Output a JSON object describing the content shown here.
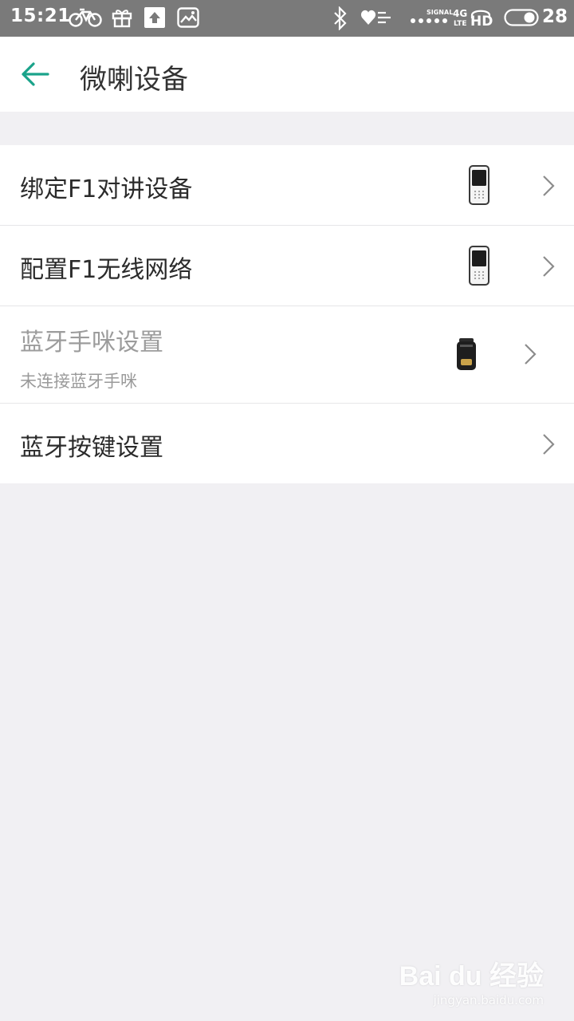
{
  "status_bar": {
    "time": "15:21",
    "signal_label": "SIGNAL",
    "network_label": "4G",
    "network_sub": "LTE",
    "hd_label": "HD",
    "battery": "28",
    "icons": [
      "bike-icon",
      "gift-icon",
      "upload-icon",
      "image-icon",
      "bluetooth-icon",
      "heart-icon",
      "signal-icon",
      "headphones-icon",
      "battery-icon"
    ]
  },
  "app_bar": {
    "title": "微喇设备",
    "back_icon": "arrow-left-icon"
  },
  "colors": {
    "accent": "#1aa38a",
    "status_bar": "#7a7a7a",
    "background": "#f1f0f3"
  },
  "items": [
    {
      "label": "绑定F1对讲设备",
      "icon": "walkie-talkie-icon"
    },
    {
      "label": "配置F1无线网络",
      "icon": "walkie-talkie-icon"
    },
    {
      "label": "蓝牙手咪设置",
      "sublabel": "未连接蓝牙手咪",
      "icon": "bluetooth-mic-icon",
      "disabled": true
    },
    {
      "label": "蓝牙按键设置"
    }
  ],
  "watermark": {
    "logo": "Bai du 经验",
    "url": "jingyan.baidu.com"
  }
}
